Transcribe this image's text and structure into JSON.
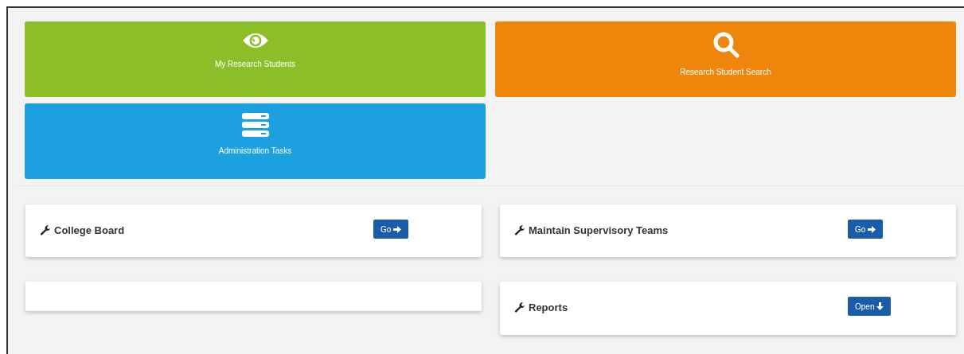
{
  "tiles": [
    {
      "label": "My Research Students",
      "kind": "eye",
      "color": "#8cbe28"
    },
    {
      "label": "Research Student Search",
      "kind": "search",
      "color": "#ee860c"
    },
    {
      "label": "Administration Tasks",
      "kind": "server",
      "color": "#1ca0e0"
    }
  ],
  "card_columns": [
    {
      "cards": [
        {
          "kind": "link",
          "title": "College Board",
          "button": {
            "label": "Go",
            "kind": "right"
          }
        },
        {
          "kind": "empty"
        }
      ]
    },
    {
      "cards": [
        {
          "kind": "link",
          "title": "Maintain Supervisory Teams",
          "button": {
            "label": "Go",
            "kind": "right"
          }
        },
        {
          "kind": "link",
          "title": "Reports",
          "button": {
            "label": "Open",
            "kind": "down"
          }
        }
      ]
    }
  ]
}
